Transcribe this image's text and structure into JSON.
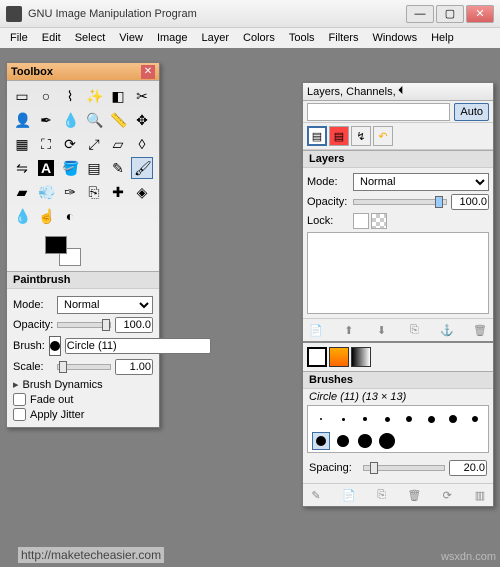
{
  "window": {
    "title": "GNU Image Manipulation Program"
  },
  "menu": [
    "File",
    "Edit",
    "Select",
    "View",
    "Image",
    "Layer",
    "Colors",
    "Tools",
    "Filters",
    "Windows",
    "Help"
  ],
  "toolbox": {
    "title": "Toolbox",
    "tools": [
      "rect-select",
      "ellipse-select",
      "lasso",
      "wand",
      "color-select",
      "scissors",
      "foreground-select",
      "paths",
      "color-picker",
      "zoom",
      "measure",
      "move",
      "align",
      "crop",
      "rotate",
      "scale",
      "shear",
      "perspective",
      "flip",
      "text",
      "bucket",
      "blend",
      "pencil",
      "paintbrush",
      "eraser",
      "airbrush",
      "ink",
      "clone",
      "heal",
      "perspective-clone",
      "blur",
      "smudge",
      "dodge"
    ],
    "section": "Paintbrush",
    "mode_label": "Mode:",
    "mode_value": "Normal",
    "opacity_label": "Opacity:",
    "opacity_value": "100.0",
    "brush_label": "Brush:",
    "brush_name": "Circle (11)",
    "scale_label": "Scale:",
    "scale_value": "1.00",
    "dynamics": "Brush Dynamics",
    "fade": "Fade out",
    "jitter": "Apply Jitter"
  },
  "dock": {
    "title": "Layers, Channels, Paths, Undo - Br...",
    "auto": "Auto",
    "layers_label": "Layers",
    "mode_label": "Mode:",
    "mode_value": "Normal",
    "opacity_label": "Opacity:",
    "opacity_value": "100.0",
    "lock_label": "Lock:",
    "brushes_label": "Brushes",
    "brush_info": "Circle (11) (13 × 13)",
    "spacing_label": "Spacing:",
    "spacing_value": "20.0"
  },
  "watermark1": "http://maketecheasier.com",
  "watermark2": "wsxdn.com"
}
